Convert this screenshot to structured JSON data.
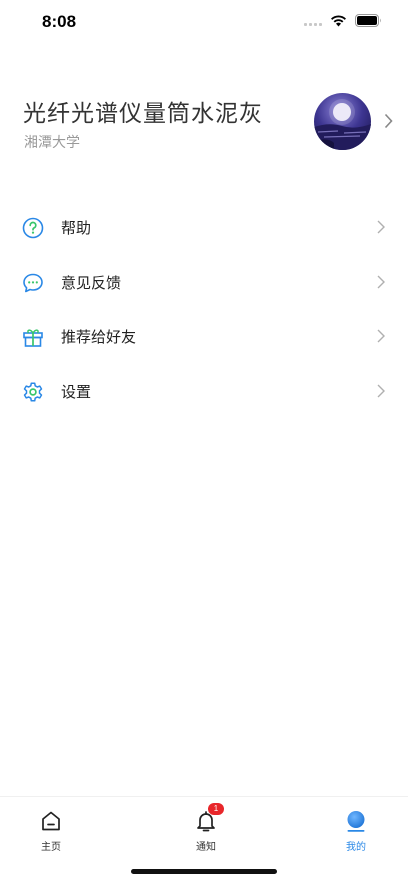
{
  "status_bar": {
    "time": "8:08",
    "icons": [
      "signal-icon",
      "wifi-icon",
      "battery-icon"
    ]
  },
  "profile": {
    "name": "光纤光谱仪量筒水泥灰",
    "school": "湘潭大学",
    "avatar_icon": "moon-landscape-avatar"
  },
  "menu": {
    "items": [
      {
        "label": "帮助",
        "icon": "help-icon"
      },
      {
        "label": "意见反馈",
        "icon": "feedback-icon"
      },
      {
        "label": "推荐给好友",
        "icon": "gift-icon"
      },
      {
        "label": "设置",
        "icon": "settings-icon"
      }
    ]
  },
  "tab_bar": {
    "tabs": [
      {
        "label": "主页",
        "icon": "home-icon"
      },
      {
        "label": "通知",
        "icon": "bell-icon",
        "badge": "1"
      },
      {
        "label": "我的",
        "icon": "profile-icon",
        "active": true
      }
    ]
  },
  "colors": {
    "accent": "#2a88e6",
    "badge": "#e8262a",
    "icon_green": "#39c66b",
    "text_secondary": "#9a9a9a"
  }
}
